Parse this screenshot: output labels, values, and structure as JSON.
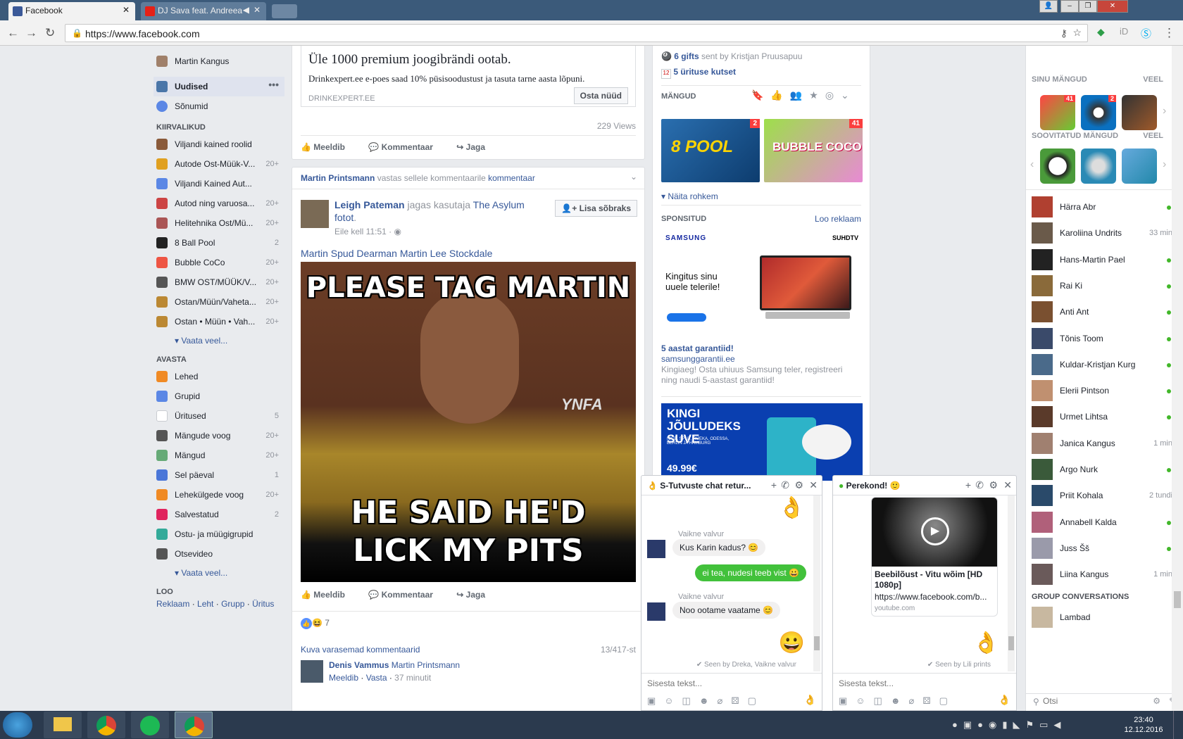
{
  "browser": {
    "tabs": [
      {
        "title": "Facebook",
        "active": true
      },
      {
        "title": "DJ Sava feat. Andreea",
        "active": false
      }
    ],
    "url": "https://www.facebook.com"
  },
  "left_nav": {
    "user_name": "Martin Kangus",
    "main": [
      {
        "label": "Uudised",
        "icon": "news-icon"
      },
      {
        "label": "Sõnumid",
        "icon": "messages-icon"
      }
    ],
    "shortcuts_header": "KIIRVALIKUD",
    "shortcuts": [
      {
        "label": "Viljandi kained roolid",
        "count": ""
      },
      {
        "label": "Autode Ost-Müük-V...",
        "count": "20+"
      },
      {
        "label": "Viljandi Kained Aut...",
        "count": ""
      },
      {
        "label": "Autod ning varuosa...",
        "count": "20+"
      },
      {
        "label": "Helitehnika Ost/Mü...",
        "count": "20+"
      },
      {
        "label": "8 Ball Pool",
        "count": "2"
      },
      {
        "label": "Bubble CoCo",
        "count": "20+"
      },
      {
        "label": "BMW OST/MÜÜK/V...",
        "count": "20+"
      },
      {
        "label": "Ostan/Müün/Vaheta...",
        "count": "20+"
      },
      {
        "label": "Ostan • Müün • Vah...",
        "count": "20+"
      }
    ],
    "see_more_1": "Vaata veel...",
    "explore_header": "AVASTA",
    "explore": [
      {
        "label": "Lehed",
        "count": ""
      },
      {
        "label": "Grupid",
        "count": ""
      },
      {
        "label": "Üritused",
        "count": "5"
      },
      {
        "label": "Mängude voog",
        "count": "20+"
      },
      {
        "label": "Mängud",
        "count": "20+"
      },
      {
        "label": "Sel päeval",
        "count": "1"
      },
      {
        "label": "Lehekülgede voog",
        "count": "20+"
      },
      {
        "label": "Salvestatud",
        "count": "2"
      },
      {
        "label": "Ostu- ja müügigrupid",
        "count": ""
      },
      {
        "label": "Otsevideo",
        "count": ""
      }
    ],
    "see_more_2": "Vaata veel...",
    "create_header": "LOO",
    "create_links": [
      "Reklaam",
      "Leht",
      "Grupp",
      "Üritus"
    ]
  },
  "feed": {
    "ad_post": {
      "headline": "Üle 1000 premium joogibrändi ootab.",
      "description": "Drinkexpert.ee e-poes saad 10% püsisoodustust ja tasuta tarne aasta lõpuni.",
      "domain": "DRINKEXPERT.EE",
      "cta": "Osta nüüd",
      "views": "229 Views"
    },
    "actions": {
      "like": "Meeldib",
      "comment": "Kommentaar",
      "share": "Jaga"
    },
    "post": {
      "activity_actor": "Martin Printsmann",
      "activity_text": "vastas sellele kommentaarile",
      "activity_link": "kommentaar",
      "author": "Leigh Pateman",
      "shared_text": "jagas kasutaja",
      "shared_from": "The Asylum",
      "shared_object": "fotot",
      "time": "Eile kell 11:51 ·",
      "add_friend": "Lisa sõbraks",
      "tags": "Martin Spud Dearman Martin Lee Stockdale",
      "image_text_top": "PLEASE TAG MARTIN",
      "image_text_bottom": "HE SAID HE'D LICK MY PITS",
      "watermark": "YNFA",
      "reactions_count": "7",
      "prev_comments": "Kuva varasemad kommentaarid",
      "comments_count": "13/417-st",
      "comment_author": "Denis Vammus",
      "comment_text": "Martin Printsmann",
      "comment_like": "Meeldib",
      "comment_reply": "Vasta",
      "comment_time": "37 minutit"
    }
  },
  "right_col": {
    "gifts_link": "6 gifts",
    "gifts_text": "sent by Kristjan Pruusapuu",
    "events_link": "5 ürituse kutset",
    "games_header": "MÄNGUD",
    "games": [
      {
        "title": "8 POOL",
        "badge": "2"
      },
      {
        "title": "BUBBLE COCO",
        "badge": "41"
      }
    ],
    "show_more": "Näita rohkem",
    "sponsored_header": "SPONSITUD",
    "create_ad": "Loo reklaam",
    "ad1_brand": "SAMSUNG",
    "ad1_brand2": "SUHDTV",
    "ad1_slogan": "Kingitus sinu uuele telerile!",
    "ad1_title": "5 aastat garantiid!",
    "ad1_domain": "samsunggarantii.ee",
    "ad1_text": "Kingiaeg! Osta uhiuus Samsung teler, registreeri ning naudi 5-aastast garantiid!",
    "ad2_title": "KINGI JÕULUDEKS SUVE",
    "ad2_text": "NICE, SPLIT, RIJEKA, ODESSA, BERLIN JA HAMBURG",
    "ad2_price": "49.99€"
  },
  "sidebar": {
    "your_games": "SINU MÄNGUD",
    "your_games_more": "VEEL",
    "your_badges": [
      "41",
      "2"
    ],
    "suggested_games": "SOOVITATUD MÄNGUD",
    "suggested_more": "VEEL",
    "friends": [
      {
        "name": "Härra Abr",
        "status": "",
        "online": true
      },
      {
        "name": "Karoliina Undrits",
        "status": "33 min",
        "online": false
      },
      {
        "name": "Hans-Martin Pael",
        "status": "",
        "online": true
      },
      {
        "name": "Rai Ki",
        "status": "",
        "online": true
      },
      {
        "name": "Anti Ant",
        "status": "",
        "online": true
      },
      {
        "name": "Tõnis Toom",
        "status": "",
        "online": true
      },
      {
        "name": "Kuldar-Kristjan Kurg",
        "status": "",
        "online": true
      },
      {
        "name": "Elerii Pintson",
        "status": "",
        "online": true
      },
      {
        "name": "Urmet Lihtsa",
        "status": "",
        "online": true
      },
      {
        "name": "Janica Kangus",
        "status": "1 min",
        "online": false
      },
      {
        "name": "Argo Nurk",
        "status": "",
        "online": true
      },
      {
        "name": "Priit Kohala",
        "status": "2 tundi",
        "online": false
      },
      {
        "name": "Annabell Kalda",
        "status": "",
        "online": true
      },
      {
        "name": "Juss Šš",
        "status": "",
        "online": true
      },
      {
        "name": "Liina Kangus",
        "status": "1 min",
        "online": false
      }
    ],
    "group_header": "GROUP CONVERSATIONS",
    "group_item": "Lambad",
    "search_placeholder": "Otsi"
  },
  "chat1": {
    "title": "S-Tutvuste chat retur...",
    "sender1": "Vaikne valvur",
    "msg1": "Kus Karin kadus? 😊",
    "msg2": "ei tea, nudesi teeb vist 😀",
    "sender2": "Vaikne valvur",
    "msg3": "Noo ootame vaatame 😊",
    "seen": "✔ Seen by Dreka, Vaikne valvur",
    "placeholder": "Sisesta tekst..."
  },
  "chat2": {
    "title": "Perekond! 🙂",
    "video_title": "Beebilõust - Vitu wõim [HD 1080p]",
    "video_url": "https://www.facebook.com/b...",
    "video_domain": "youtube.com",
    "seen": "✔ Seen by Lili prints",
    "placeholder": "Sisesta tekst..."
  },
  "taskbar": {
    "time": "23:40",
    "date": "12.12.2016"
  },
  "colors": {
    "fb_blue": "#365899",
    "online_green": "#42b72a",
    "page_bg": "#e9ebee"
  }
}
